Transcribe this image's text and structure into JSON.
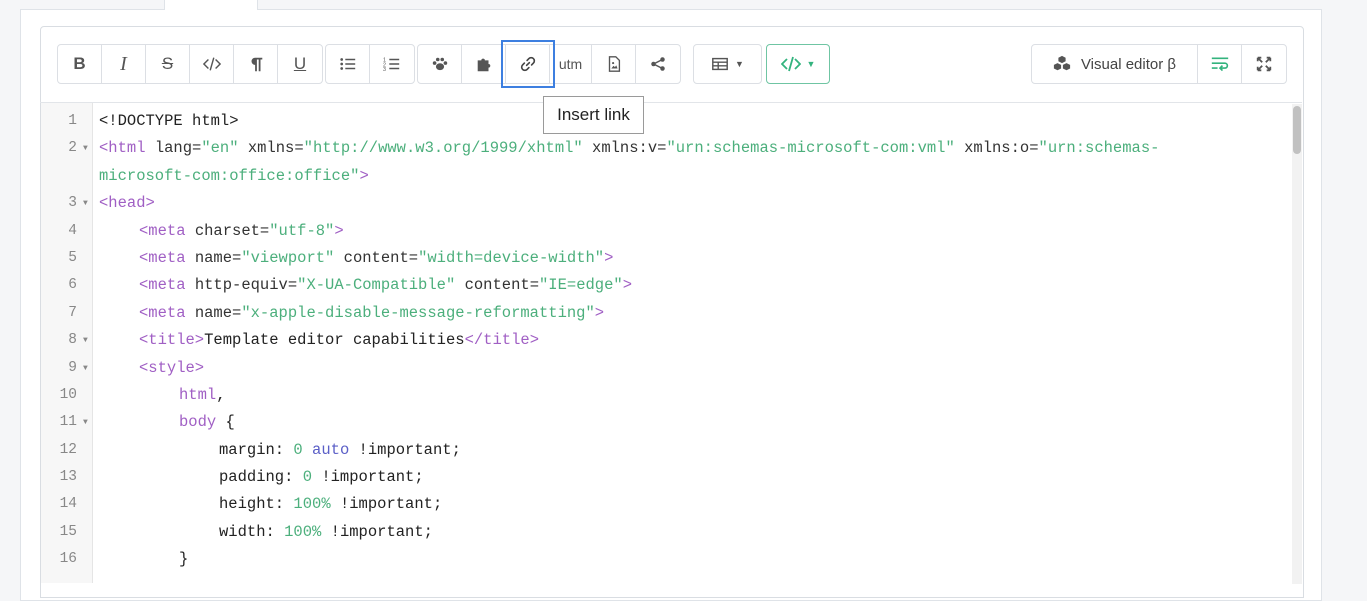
{
  "toolbar": {
    "utm_label": "utm",
    "visual_editor_label": "Visual editor β",
    "tooltip": "Insert link"
  },
  "colors": {
    "accent_green": "#33b37e",
    "active_outline": "#3d7fe0",
    "tag": "#a05fc4",
    "string": "#4caf7c"
  },
  "code": [
    {
      "n": "1",
      "fold": false,
      "indent": 0,
      "parts": [
        [
          "t",
          "<!DOCTYPE html>"
        ]
      ]
    },
    {
      "n": "2",
      "fold": true,
      "indent": 0,
      "parts": [
        [
          "tag",
          "<html "
        ],
        [
          "a",
          "lang="
        ],
        [
          "s",
          "\"en\""
        ],
        [
          "a",
          " xmlns="
        ],
        [
          "s",
          "\"http://www.w3.org/1999/xhtml\""
        ],
        [
          "a",
          " xmlns:v="
        ],
        [
          "s",
          "\"urn:schemas-microsoft-com:vml\""
        ],
        [
          "a",
          " xmlns:o="
        ],
        [
          "s",
          "\"urn:schemas-"
        ]
      ]
    },
    {
      "n": "",
      "fold": false,
      "indent": 0,
      "parts": [
        [
          "s",
          "microsoft-com:office:office\""
        ],
        [
          "tag",
          ">"
        ]
      ]
    },
    {
      "n": "3",
      "fold": true,
      "indent": 0,
      "parts": [
        [
          "tag",
          "<head>"
        ]
      ]
    },
    {
      "n": "4",
      "fold": false,
      "indent": 1,
      "parts": [
        [
          "tag",
          "<meta "
        ],
        [
          "a",
          "charset="
        ],
        [
          "s",
          "\"utf-8\""
        ],
        [
          "tag",
          ">"
        ]
      ]
    },
    {
      "n": "5",
      "fold": false,
      "indent": 1,
      "parts": [
        [
          "tag",
          "<meta "
        ],
        [
          "a",
          "name="
        ],
        [
          "s",
          "\"viewport\""
        ],
        [
          "a",
          " content="
        ],
        [
          "s",
          "\"width=device-width\""
        ],
        [
          "tag",
          ">"
        ]
      ]
    },
    {
      "n": "6",
      "fold": false,
      "indent": 1,
      "parts": [
        [
          "tag",
          "<meta "
        ],
        [
          "a",
          "http-equiv="
        ],
        [
          "s",
          "\"X-UA-Compatible\""
        ],
        [
          "a",
          " content="
        ],
        [
          "s",
          "\"IE=edge\""
        ],
        [
          "tag",
          ">"
        ]
      ]
    },
    {
      "n": "7",
      "fold": false,
      "indent": 1,
      "parts": [
        [
          "tag",
          "<meta "
        ],
        [
          "a",
          "name="
        ],
        [
          "s",
          "\"x-apple-disable-message-reformatting\""
        ],
        [
          "tag",
          ">"
        ]
      ]
    },
    {
      "n": "8",
      "fold": true,
      "indent": 1,
      "parts": [
        [
          "tag",
          "<title>"
        ],
        [
          "t",
          "Template editor capabilities"
        ],
        [
          "tag",
          "</title>"
        ]
      ]
    },
    {
      "n": "9",
      "fold": true,
      "indent": 1,
      "parts": [
        [
          "tag",
          "<style>"
        ]
      ]
    },
    {
      "n": "10",
      "fold": false,
      "indent": 2,
      "parts": [
        [
          "tag",
          "html"
        ],
        [
          "t",
          ","
        ]
      ]
    },
    {
      "n": "11",
      "fold": true,
      "indent": 2,
      "parts": [
        [
          "tag",
          "body"
        ],
        [
          "t",
          " {"
        ]
      ]
    },
    {
      "n": "12",
      "fold": false,
      "indent": 3,
      "parts": [
        [
          "t",
          "margin: "
        ],
        [
          "num",
          "0"
        ],
        [
          "kw",
          " auto"
        ],
        [
          "t",
          " !important;"
        ]
      ]
    },
    {
      "n": "13",
      "fold": false,
      "indent": 3,
      "parts": [
        [
          "t",
          "padding: "
        ],
        [
          "num",
          "0"
        ],
        [
          "t",
          " !important;"
        ]
      ]
    },
    {
      "n": "14",
      "fold": false,
      "indent": 3,
      "parts": [
        [
          "t",
          "height: "
        ],
        [
          "num",
          "100%"
        ],
        [
          "t",
          " !important;"
        ]
      ]
    },
    {
      "n": "15",
      "fold": false,
      "indent": 3,
      "parts": [
        [
          "t",
          "width: "
        ],
        [
          "num",
          "100%"
        ],
        [
          "t",
          " !important;"
        ]
      ]
    },
    {
      "n": "16",
      "fold": false,
      "indent": 2,
      "parts": [
        [
          "t",
          "}"
        ]
      ]
    }
  ]
}
